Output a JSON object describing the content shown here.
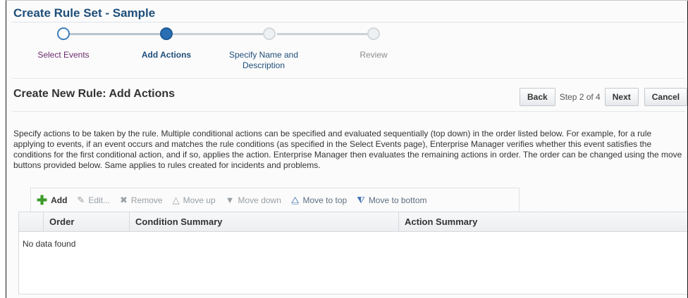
{
  "page_title": "Create Rule Set - Sample",
  "train": {
    "steps": [
      {
        "label": "Select Events",
        "state": "visited"
      },
      {
        "label": "Add Actions",
        "state": "current"
      },
      {
        "label": "Specify Name and Description",
        "state": "pending"
      },
      {
        "label": "Review",
        "state": "future"
      }
    ]
  },
  "section": {
    "title": "Create New Rule: Add Actions",
    "back_label": "Back",
    "step_text": "Step 2 of 4",
    "next_label": "Next",
    "cancel_label": "Cancel"
  },
  "description": "Specify actions to be taken by the rule. Multiple conditional actions can be specified and evaluated sequentially (top down) in the order listed below. For example, for a rule applying to events, if an event occurs and matches the rule conditions (as specified in the Select Events page), Enterprise Manager verifies whether this event satisfies the conditions for the first conditional action, and if so, applies the action. Enterprise Manager then evaluates the remaining actions in order. The order can be changed using the move buttons provided below. Same applies to rules created for incidents and problems.",
  "toolbar": {
    "add": "Add",
    "edit": "Edit...",
    "remove": "Remove",
    "move_up": "Move up",
    "move_down": "Move down",
    "move_top": "Move to top",
    "move_bottom": "Move to bottom"
  },
  "table": {
    "columns": [
      "Order",
      "Condition Summary",
      "Action Summary"
    ],
    "empty_text": "No data found"
  },
  "colors": {
    "title_blue": "#1e4e79",
    "current_step": "#2a6fb3",
    "add_green": "#3c9a2a"
  }
}
